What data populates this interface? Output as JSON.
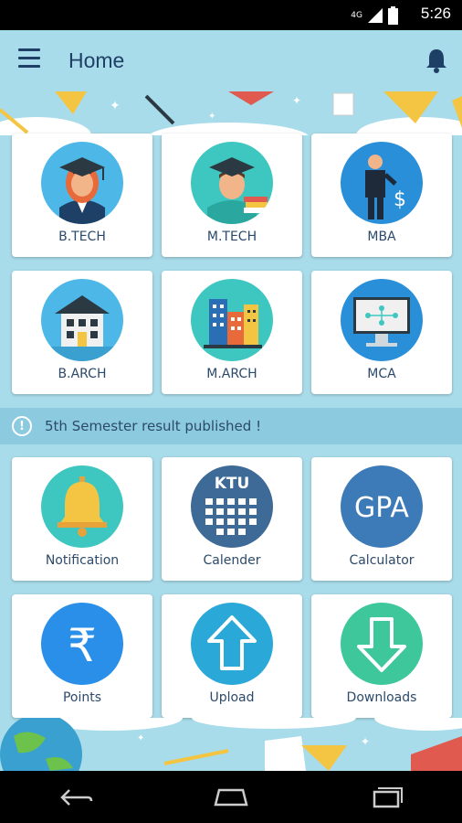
{
  "status_bar": {
    "time": "5:26",
    "network": "4G"
  },
  "app_bar": {
    "title": "Home"
  },
  "courses": [
    {
      "label": "B.TECH",
      "icon": "graduate-woman-icon"
    },
    {
      "label": "M.TECH",
      "icon": "graduate-man-icon"
    },
    {
      "label": "MBA",
      "icon": "businessman-icon"
    },
    {
      "label": "B.ARCH",
      "icon": "house-icon"
    },
    {
      "label": "M.ARCH",
      "icon": "buildings-icon"
    },
    {
      "label": "MCA",
      "icon": "computer-icon"
    }
  ],
  "notice": {
    "text": "5th Semester result published !"
  },
  "tools": [
    {
      "label": "Notification",
      "icon": "bell-icon"
    },
    {
      "label": "Calender",
      "icon": "calendar-icon",
      "badge": "KTU"
    },
    {
      "label": "Calculator",
      "icon": "gpa-icon",
      "badge": "GPA"
    },
    {
      "label": "Points",
      "icon": "rupee-icon",
      "glyph": "₹"
    },
    {
      "label": "Upload",
      "icon": "upload-icon"
    },
    {
      "label": "Downloads",
      "icon": "download-icon"
    }
  ],
  "colors": {
    "app_bar": "#a9dcea",
    "accent": "#1e3f66",
    "notice_bg": "#8ccadf"
  }
}
